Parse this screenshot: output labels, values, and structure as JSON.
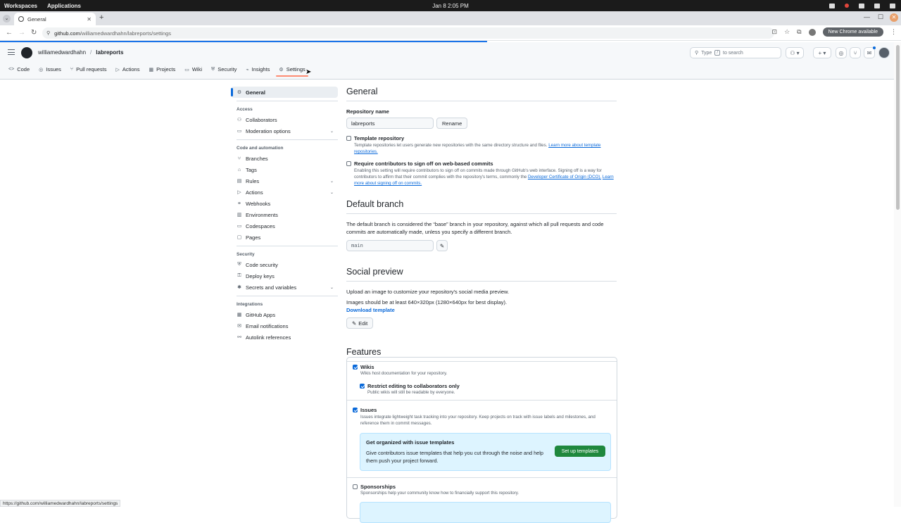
{
  "os": {
    "workspaces": "Workspaces",
    "applications": "Applications",
    "clock": "Jan 8   2:05 PM"
  },
  "browser": {
    "tab_title": "General",
    "url_host": "github.com",
    "url_path": "/williamedwardhahn/labreports/settings",
    "new_chrome": "New Chrome available",
    "status_url": "https://github.com/williamedwardhahn/labreports/settings"
  },
  "header": {
    "owner": "williamedwardhahn",
    "separator": "/",
    "repo": "labreports",
    "search_prefix": "Type",
    "search_key": "/",
    "search_suffix": "to search"
  },
  "repo_nav": [
    {
      "label": "Code",
      "icon": "<>"
    },
    {
      "label": "Issues",
      "icon": "◎"
    },
    {
      "label": "Pull requests",
      "icon": "⑂"
    },
    {
      "label": "Actions",
      "icon": "▷"
    },
    {
      "label": "Projects",
      "icon": "▦"
    },
    {
      "label": "Wiki",
      "icon": "▭"
    },
    {
      "label": "Security",
      "icon": "⛨"
    },
    {
      "label": "Insights",
      "icon": "⌁"
    },
    {
      "label": "Settings",
      "icon": "⚙"
    }
  ],
  "sidebar": {
    "general": "General",
    "access_heading": "Access",
    "collaborators": "Collaborators",
    "moderation": "Moderation options",
    "code_heading": "Code and automation",
    "branches": "Branches",
    "tags": "Tags",
    "rules": "Rules",
    "actions": "Actions",
    "webhooks": "Webhooks",
    "environments": "Environments",
    "codespaces": "Codespaces",
    "pages": "Pages",
    "security_heading": "Security",
    "code_security": "Code security",
    "deploy_keys": "Deploy keys",
    "secrets": "Secrets and variables",
    "integrations_heading": "Integrations",
    "github_apps": "GitHub Apps",
    "email_notifications": "Email notifications",
    "autolink": "Autolink references"
  },
  "general": {
    "title": "General",
    "repo_name_label": "Repository name",
    "repo_name_value": "labreports",
    "rename_button": "Rename",
    "template_label": "Template repository",
    "template_note": "Template repositories let users generate new repositories with the same directory structure and files.",
    "template_link": "Learn more about template repositories.",
    "signoff_label": "Require contributors to sign off on web-based commits",
    "signoff_note": "Enabling this setting will require contributors to sign off on commits made through GitHub's web interface. Signing off is a way for contributors to affirm that their commit complies with the repository's terms, commonly the",
    "signoff_link1": "Developer Certificate of Origin (DCO).",
    "signoff_link2": "Learn more about signing off on commits."
  },
  "default_branch": {
    "title": "Default branch",
    "description": "The default branch is considered the “base” branch in your repository, against which all pull requests and code commits are automatically made, unless you specify a different branch.",
    "branch": "main"
  },
  "social_preview": {
    "title": "Social preview",
    "line1": "Upload an image to customize your repository's social media preview.",
    "line2": "Images should be at least 640×320px (1280×640px for best display).",
    "download": "Download template",
    "edit": "Edit"
  },
  "features": {
    "title": "Features",
    "wikis": "Wikis",
    "wikis_note": "Wikis host documentation for your repository.",
    "restrict": "Restrict editing to collaborators only",
    "restrict_note": "Public wikis will still be readable by everyone.",
    "issues": "Issues",
    "issues_note": "Issues integrate lightweight task tracking into your repository. Keep projects on track with issue labels and milestones, and reference them in commit messages.",
    "callout_title": "Get organized with issue templates",
    "callout_body": "Give contributors issue templates that help you cut through the noise and help them push your project forward.",
    "setup_button": "Set up templates",
    "sponsorships": "Sponsorships",
    "sponsorships_note": "Sponsorships help your community know how to financially support this repository."
  },
  "colors": {
    "accent": "#0969da",
    "green": "#1f883d",
    "underline": "#fd8c73"
  }
}
